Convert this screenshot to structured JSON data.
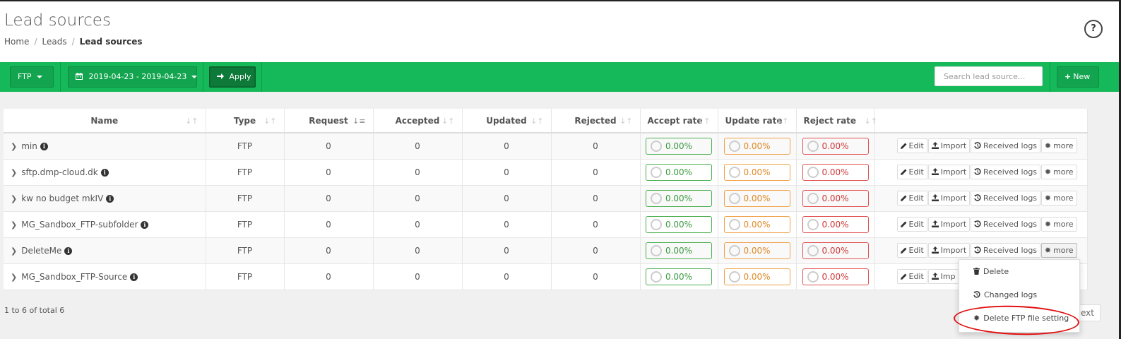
{
  "page": {
    "title": "Lead sources",
    "help_label": "?"
  },
  "breadcrumb": {
    "home": "Home",
    "leads": "Leads",
    "current": "Lead sources",
    "separator": "/"
  },
  "toolbar": {
    "type_filter": "FTP",
    "date_range": "2019-04-23 - 2019-04-23",
    "apply_label": "Apply",
    "search_placeholder": "Search lead source...",
    "new_label": "New",
    "color": "#16b95a"
  },
  "table": {
    "columns": [
      "Name",
      "Type",
      "Request",
      "Accepted",
      "Updated",
      "Rejected",
      "Accept rate",
      "Update rate",
      "Reject rate",
      ""
    ],
    "rows": [
      {
        "name": "min",
        "type": "FTP",
        "request": "0",
        "accepted": "0",
        "updated": "0",
        "rejected": "0",
        "accept_rate": "0.00%",
        "update_rate": "0.00%",
        "reject_rate": "0.00%"
      },
      {
        "name": "sftp.dmp-cloud.dk",
        "type": "FTP",
        "request": "0",
        "accepted": "0",
        "updated": "0",
        "rejected": "0",
        "accept_rate": "0.00%",
        "update_rate": "0.00%",
        "reject_rate": "0.00%"
      },
      {
        "name": "kw no budget mkIV",
        "type": "FTP",
        "request": "0",
        "accepted": "0",
        "updated": "0",
        "rejected": "0",
        "accept_rate": "0.00%",
        "update_rate": "0.00%",
        "reject_rate": "0.00%"
      },
      {
        "name": "MG_Sandbox_FTP-subfolder",
        "type": "FTP",
        "request": "0",
        "accepted": "0",
        "updated": "0",
        "rejected": "0",
        "accept_rate": "0.00%",
        "update_rate": "0.00%",
        "reject_rate": "0.00%"
      },
      {
        "name": "DeleteMe",
        "type": "FTP",
        "request": "0",
        "accepted": "0",
        "updated": "0",
        "rejected": "0",
        "accept_rate": "0.00%",
        "update_rate": "0.00%",
        "reject_rate": "0.00%"
      },
      {
        "name": "MG_Sandbox_FTP-Source",
        "type": "FTP",
        "request": "0",
        "accepted": "0",
        "updated": "0",
        "rejected": "0",
        "accept_rate": "0.00%",
        "update_rate": "0.00%",
        "reject_rate": "0.00%"
      }
    ],
    "actions": {
      "edit": "Edit",
      "import": "Import",
      "received_logs": "Received logs",
      "more": "more",
      "import_truncated": "Imp"
    }
  },
  "dropdown": {
    "delete": "Delete",
    "changed_logs": "Changed logs",
    "delete_ftp": "Delete FTP file setting"
  },
  "footer": {
    "summary": "1 to 6 of total 6",
    "next_label": "Next",
    "next_visible": "Next"
  },
  "colors": {
    "accept": "#4caf50",
    "update": "#f0a24a",
    "reject": "#e05252",
    "annotation": "#e01010"
  }
}
